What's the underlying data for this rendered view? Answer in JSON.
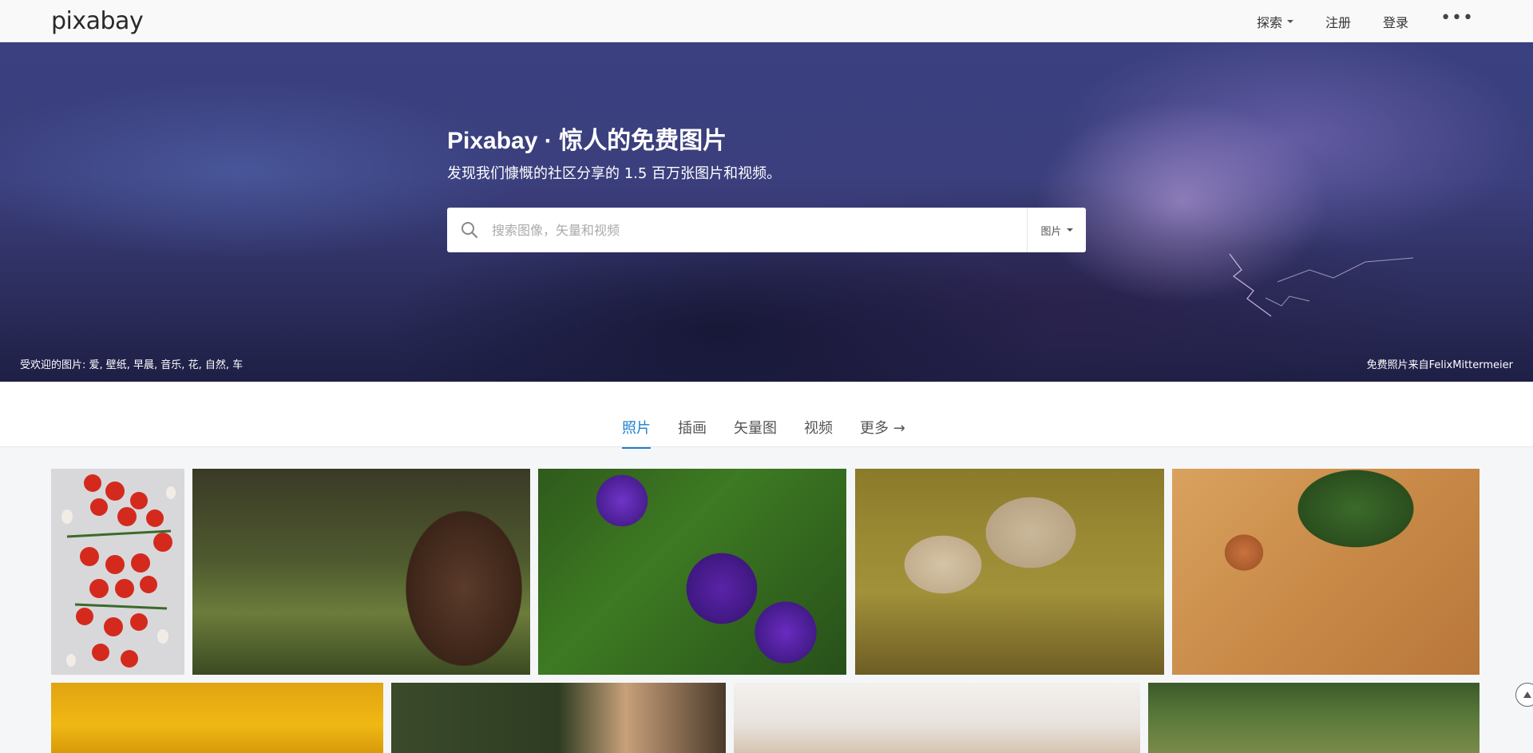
{
  "header": {
    "logo": "pixabay",
    "nav": {
      "explore": "探索",
      "signup": "注册",
      "login": "登录",
      "more": "•••"
    }
  },
  "hero": {
    "title": "Pixabay · 惊人的免费图片",
    "subtitle": "发现我们慷慨的社区分享的 1.5 百万张图片和视频。",
    "search": {
      "placeholder": "搜索图像，矢量和视频",
      "value": "",
      "type": "图片"
    },
    "popular": "受欢迎的图片: 爱, 壁纸, 早晨, 音乐, 花, 自然, 车",
    "credit": "免费照片来自FelixMittermeier"
  },
  "tabs": [
    "照片",
    "插画",
    "矢量图",
    "视频",
    "更多 →"
  ],
  "active_tab": "照片",
  "colors": {
    "accent": "#1f7fcf",
    "header_bg": "#f9f9f9",
    "hero_bg": "#3b3f7d"
  },
  "photos": [
    {
      "subject": "tomatoes"
    },
    {
      "subject": "eagle"
    },
    {
      "subject": "purple morning glory flowers"
    },
    {
      "subject": "sheep"
    },
    {
      "subject": "pasta and egg"
    },
    {
      "subject": "yellow flower"
    },
    {
      "subject": "white horse and girl"
    },
    {
      "subject": "pasta dish"
    },
    {
      "subject": "wildflowers"
    }
  ]
}
